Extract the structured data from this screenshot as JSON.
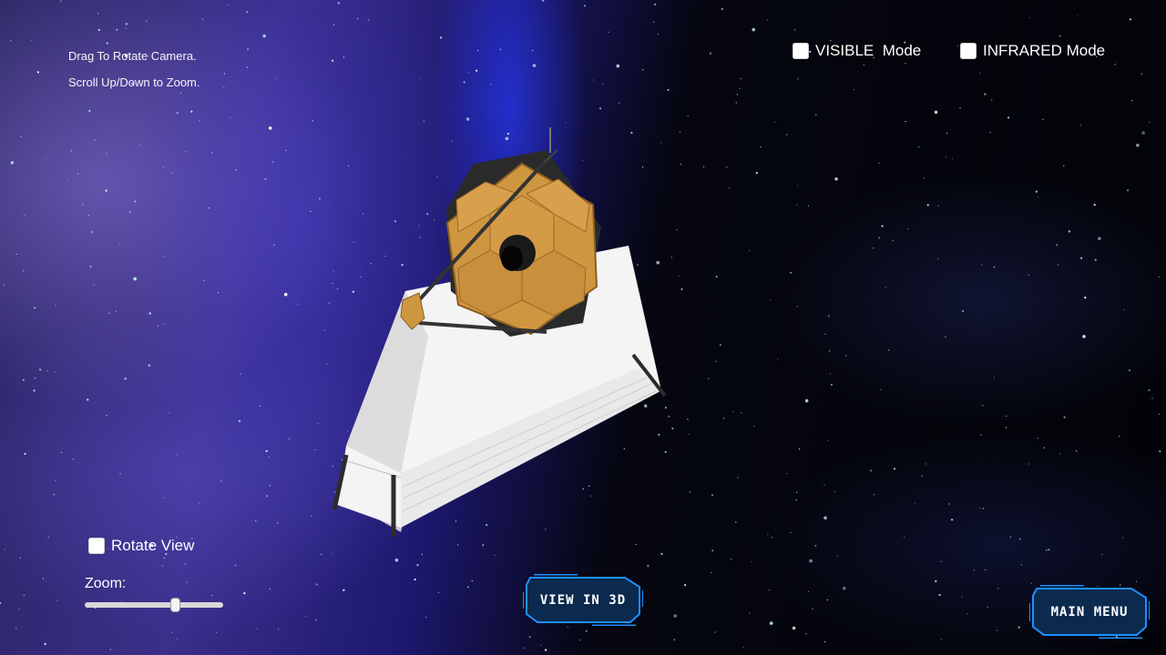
{
  "hints": {
    "rotate": "Drag To Rotate Camera.",
    "zoom": "Scroll Up/Down to Zoom."
  },
  "modes": {
    "visible_label": "VISIBLE  Mode",
    "visible_checked": false,
    "infrared_label": "INFRARED Mode",
    "infrared_checked": false
  },
  "rotate_view": {
    "label": "Rotate View",
    "checked": false
  },
  "zoom": {
    "label": "Zoom:",
    "value": 0.65
  },
  "buttons": {
    "view_3d": "VIEW IN 3D",
    "main_menu": "MAIN MENU"
  },
  "colors": {
    "button_fill": "#0b2a4e",
    "button_border": "#1f8fff",
    "mirror_gold": "#cf9640",
    "sunshield": "#ececec"
  }
}
